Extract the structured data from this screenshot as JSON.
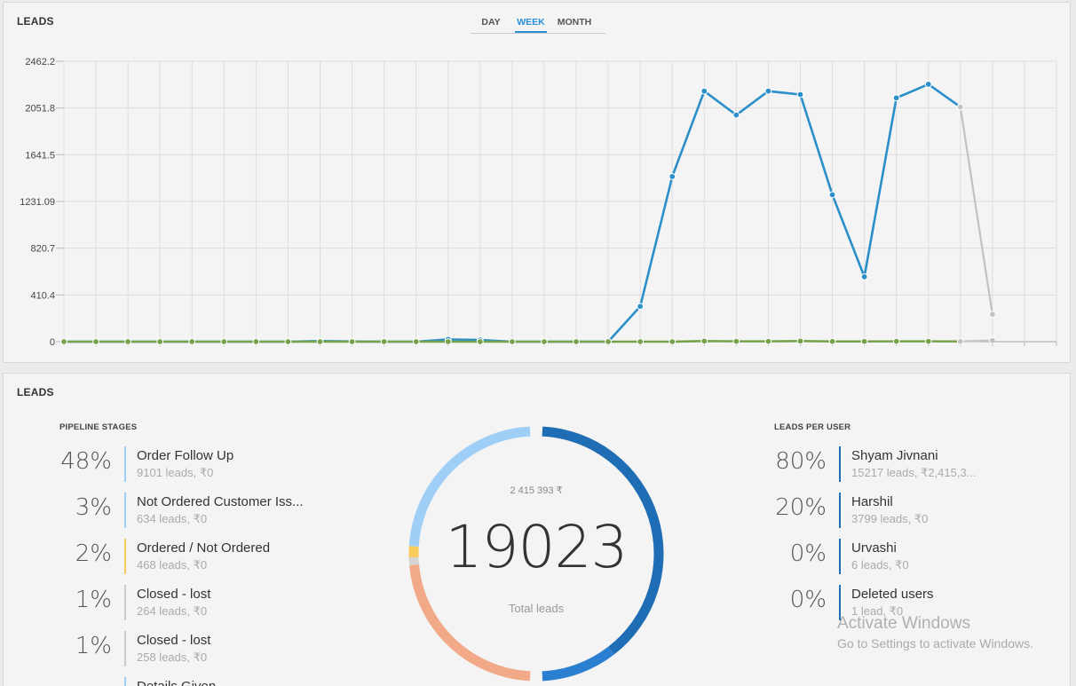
{
  "top_panel": {
    "title": "LEADS",
    "tabs": [
      {
        "label": "DAY",
        "active": false
      },
      {
        "label": "WEEK",
        "active": true
      },
      {
        "label": "MONTH",
        "active": false
      }
    ]
  },
  "chart_data": {
    "type": "line",
    "title": "",
    "xlabel": "",
    "ylabel": "",
    "y_tick_labels": [
      "0",
      "410.4",
      "820.7",
      "1231.09",
      "1641.5",
      "2051.8",
      "2462.2"
    ],
    "ylim": [
      0,
      2462.2
    ],
    "grid": true,
    "series": [
      {
        "color": "#2b8fc9",
        "values": [
          0,
          0,
          0,
          0,
          0,
          0,
          0,
          0,
          5,
          2,
          0,
          0,
          20,
          15,
          0,
          0,
          0,
          0,
          310,
          1450,
          2200,
          1990,
          2200,
          2170,
          1290,
          570,
          2140,
          2260,
          2060
        ]
      },
      {
        "color": "#77a24b",
        "values": [
          0,
          0,
          0,
          0,
          0,
          0,
          0,
          0,
          0,
          0,
          0,
          0,
          0,
          0,
          0,
          0,
          0,
          0,
          0,
          0,
          5,
          3,
          3,
          5,
          2,
          2,
          3,
          3,
          2
        ]
      },
      {
        "color": "#c2c2c2",
        "values": [
          null,
          null,
          null,
          null,
          null,
          null,
          null,
          null,
          null,
          null,
          null,
          null,
          null,
          null,
          null,
          null,
          null,
          null,
          null,
          null,
          null,
          null,
          null,
          null,
          null,
          null,
          null,
          null,
          2060,
          240
        ]
      },
      {
        "color": "#c2c2c2",
        "values": [
          null,
          null,
          null,
          null,
          null,
          null,
          null,
          null,
          null,
          null,
          null,
          null,
          null,
          null,
          null,
          null,
          null,
          null,
          null,
          null,
          null,
          null,
          null,
          null,
          null,
          null,
          null,
          null,
          2,
          10
        ]
      }
    ]
  },
  "bottom_panel": {
    "title": "LEADS",
    "pipeline_label": "PIPELINE STAGES",
    "users_label": "LEADS PER USER",
    "stages": [
      {
        "pct": "48%",
        "name": "Order Follow Up",
        "sub": "9101 leads, ₹0",
        "color": "#9fcff7"
      },
      {
        "pct": "3%",
        "name": "Not Ordered Customer Iss...",
        "sub": "634 leads, ₹0",
        "color": "#9fcff7"
      },
      {
        "pct": "2%",
        "name": "Ordered / Not Ordered",
        "sub": "468 leads, ₹0",
        "color": "#f8cc5c"
      },
      {
        "pct": "1%",
        "name": "Closed - lost",
        "sub": "264 leads, ₹0",
        "color": "#cccccc"
      },
      {
        "pct": "1%",
        "name": "Closed - lost",
        "sub": "258 leads, ₹0",
        "color": "#cccccc"
      },
      {
        "pct": "",
        "name": "Details Given",
        "sub": "",
        "color": "#9fcff7"
      }
    ],
    "users": [
      {
        "pct": "80%",
        "name": "Shyam Jivnani",
        "sub": "15217 leads, ₹2,415,3...",
        "color": "#1f6db4"
      },
      {
        "pct": "20%",
        "name": "Harshil",
        "sub": "3799 leads, ₹0",
        "color": "#1f6db4"
      },
      {
        "pct": "0%",
        "name": "Urvashi",
        "sub": "6 leads, ₹0",
        "color": "#1f6db4"
      },
      {
        "pct": "0%",
        "name": "Deleted users",
        "sub": "1 lead, ₹0",
        "color": "#1f6db4"
      }
    ],
    "donut": {
      "amount": "2 415 393 ₹",
      "total": "19023",
      "caption": "Total leads",
      "outer_segments": [
        {
          "value": 80,
          "color": "#1f6db4"
        },
        {
          "value": 20,
          "color": "#2a7fd1"
        }
      ],
      "inner_segments": [
        {
          "value": 48,
          "color": "#9fcff7"
        },
        {
          "value": 3,
          "color": "#f8cc5c"
        },
        {
          "value": 2,
          "color": "#d5d5d5"
        },
        {
          "value": 47,
          "color": "#f2a987"
        }
      ]
    }
  },
  "watermark": {
    "title": "Activate Windows",
    "sub": "Go to Settings to activate Windows."
  }
}
